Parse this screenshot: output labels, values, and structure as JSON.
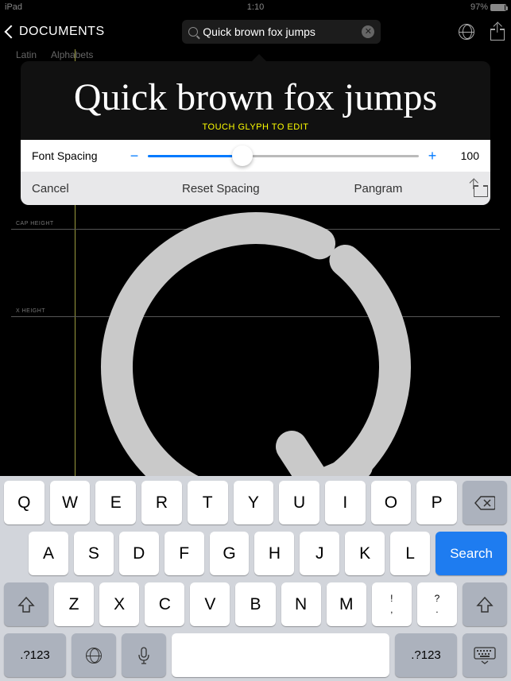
{
  "status": {
    "device": "iPad",
    "time": "1:10",
    "battery": "97%"
  },
  "nav": {
    "back": "DOCUMENTS",
    "search_value": "Quick brown fox jumps"
  },
  "breadcrumb": {
    "a": "Latin",
    "b": "Alphabets"
  },
  "popover": {
    "preview": "Quick brown fox jumps",
    "hint": "TOUCH GLYPH TO EDIT",
    "spacing_label": "Font Spacing",
    "spacing_value": "100",
    "cancel": "Cancel",
    "reset": "Reset Spacing",
    "pangram": "Pangram"
  },
  "guides": {
    "cap": "CAP HEIGHT",
    "x": "X HEIGHT"
  },
  "keyboard": {
    "r1": [
      "Q",
      "W",
      "E",
      "R",
      "T",
      "Y",
      "U",
      "I",
      "O",
      "P"
    ],
    "r2": [
      "A",
      "S",
      "D",
      "F",
      "G",
      "H",
      "J",
      "K",
      "L"
    ],
    "r3": [
      "Z",
      "X",
      "C",
      "V",
      "B",
      "N",
      "M"
    ],
    "punct1_top": "!",
    "punct1_bot": ",",
    "punct2_top": "?",
    "punct2_bot": ".",
    "search": "Search",
    "numkey": ".?123",
    "bksp": "⌫"
  }
}
